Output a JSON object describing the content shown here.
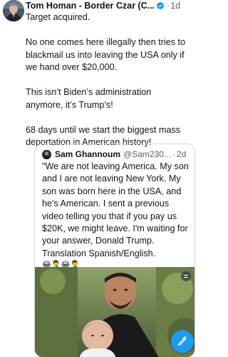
{
  "tweet": {
    "author": {
      "display_name": "Tom Homan - Border Czar (C...",
      "verified": true,
      "avatar_icon": "profile-photo"
    },
    "separator": "·",
    "timestamp": "1d",
    "lines": [
      "Target acquired.",
      "",
      "No one comes here illegally then tries to",
      "blackmail us into leaving the USA only if",
      "we hand over $20,000.",
      "",
      "This isn’t Biden’s administration",
      "anymore, it’s Trump’s!",
      "",
      "68 days until we start the biggest mass",
      "deportation in American history!"
    ]
  },
  "quoted": {
    "display_name": "Sam Ghannoum",
    "handle": "@Sam230...",
    "separator": "·",
    "timestamp": "2d",
    "lines": [
      "\"We are not leaving America. My son",
      "and I are not leaving New York. My",
      "son was born here in the USA, and",
      "he's American. I sent a previous",
      "video telling you that if you pay us",
      "$20K, we might leave. I'm waiting for",
      "your answer, Donald Trump.",
      "Translation Spanish/English."
    ],
    "emojis": "😂🤦‍♂️😂🤦‍♂️",
    "media_icon": "video-thumbnail"
  },
  "colors": {
    "accent": "#1d9bf0",
    "text_primary": "#0f1419",
    "text_secondary": "#536471",
    "border": "#cfd9de"
  },
  "compose_button_icon": "compose-plus-icon"
}
